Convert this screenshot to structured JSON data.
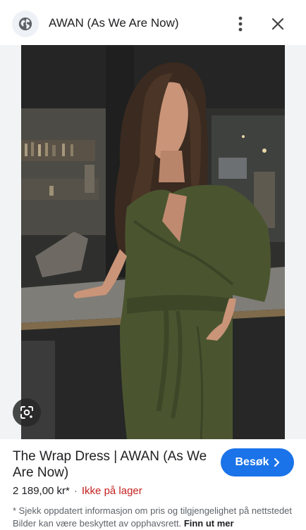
{
  "header": {
    "site_icon": "globe-icon",
    "title": "AWAN (As We Are Now)",
    "more_icon": "more-vert-icon",
    "close_icon": "close-icon"
  },
  "image": {
    "lens_icon": "google-lens-icon"
  },
  "product": {
    "title": "The Wrap Dress | AWAN (As We Are Now)",
    "visit_label": "Besøk",
    "visit_icon": "chevron-right-icon",
    "price": "2 189,00 kr*",
    "separator": "·",
    "stock_status": "Ikke på lager"
  },
  "disclaimer": {
    "text": "* Sjekk oppdatert informasjon om pris og tilgjengelighet på nettstedet Bilder kan være beskyttet av opphavsrett.",
    "link": "Finn ut mer"
  },
  "colors": {
    "accent": "#1a73e8",
    "out_of_stock": "#c5221f",
    "dress": "#4a5530"
  }
}
